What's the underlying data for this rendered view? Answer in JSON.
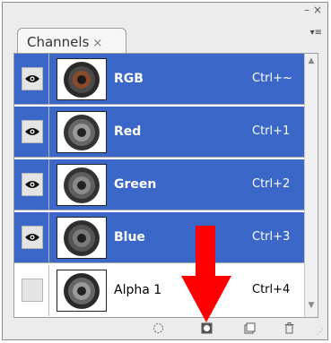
{
  "panel": {
    "tab_label": "Channels",
    "tab_close": "×",
    "window_controls": "– ×",
    "menu_glyph": "▾≡"
  },
  "channels": [
    {
      "name": "RGB",
      "shortcut": "Ctrl+~",
      "visible": true,
      "selected": true
    },
    {
      "name": "Red",
      "shortcut": "Ctrl+1",
      "visible": true,
      "selected": true
    },
    {
      "name": "Green",
      "shortcut": "Ctrl+2",
      "visible": true,
      "selected": true
    },
    {
      "name": "Blue",
      "shortcut": "Ctrl+3",
      "visible": true,
      "selected": true
    },
    {
      "name": "Alpha 1",
      "shortcut": "Ctrl+4",
      "visible": false,
      "selected": false
    }
  ],
  "bottom_buttons": [
    {
      "icon": "load-selection-icon"
    },
    {
      "icon": "save-selection-icon"
    },
    {
      "icon": "new-channel-icon"
    },
    {
      "icon": "trash-icon"
    }
  ],
  "colors": {
    "selection": "#3a67c8",
    "annotation_arrow": "#ff0000"
  }
}
